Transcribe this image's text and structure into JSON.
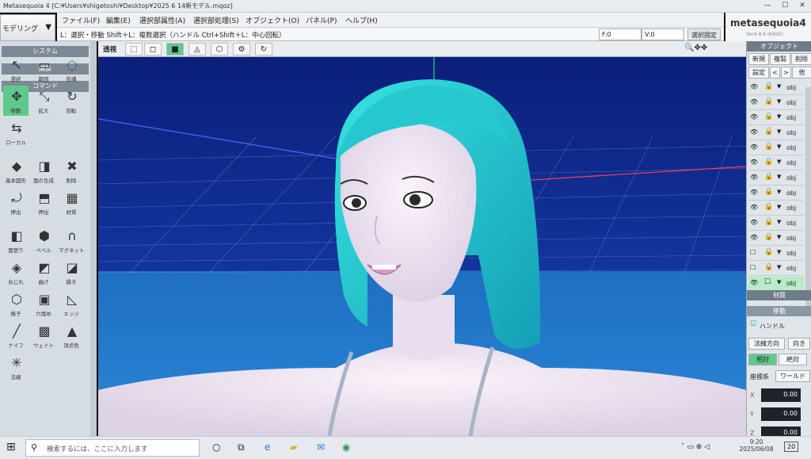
{
  "window": {
    "title": "Metasequoia 4 [C:¥Users¥shigetoshi¥Desktop¥2025 6 14新モデル.mqoz]",
    "min": "—",
    "max": "☐",
    "close": "✕"
  },
  "mode": {
    "label": "モデリング",
    "arrow": "▼"
  },
  "menu": [
    "ファイル(F)",
    "編集(E)",
    "選択部属性(A)",
    "選択部処理(S)",
    "オブジェクト(O)",
    "パネル(P)",
    "ヘルプ(H)"
  ],
  "hint": {
    "text": "L：選択・移動  Shift＋L：複数選択（ハンドル  Ctrl+Shift＋L：中心回転）",
    "f_label": "F:0",
    "v_label": "V:0",
    "fix_label": "選択固定"
  },
  "brand": {
    "name": "metasequoia4",
    "version": "Ver4.8.6 (64bit)"
  },
  "left": {
    "system": "システム",
    "edit": "編集",
    "command": "コマンド",
    "tools": [
      {
        "icon": "↖",
        "label": "選択"
      },
      {
        "icon": "▭",
        "label": "範囲"
      },
      {
        "icon": "◌",
        "label": "投縄"
      },
      {
        "icon": "✥",
        "label": "移動"
      },
      {
        "icon": "⤡",
        "label": "拡大"
      },
      {
        "icon": "↻",
        "label": "回転"
      },
      {
        "icon": "⇆",
        "label": "ローカル"
      },
      {
        "icon": "◆",
        "label": "基本図形"
      },
      {
        "icon": "◨",
        "label": "面の生成"
      },
      {
        "icon": "✖",
        "label": "削除"
      },
      {
        "icon": "⤾",
        "label": "押出"
      },
      {
        "icon": "⬒",
        "label": "押出"
      },
      {
        "icon": "▦",
        "label": "材質"
      },
      {
        "icon": "◧",
        "label": "面張り"
      },
      {
        "icon": "⬢",
        "label": "ベベル"
      },
      {
        "icon": "∩",
        "label": "マグネット"
      },
      {
        "icon": "◈",
        "label": "ねじれ"
      },
      {
        "icon": "◩",
        "label": "曲げ"
      },
      {
        "icon": "◪",
        "label": "縁き"
      },
      {
        "icon": "⬡",
        "label": "格子"
      },
      {
        "icon": "▣",
        "label": "穴埋め"
      },
      {
        "icon": "◺",
        "label": "エッジ"
      },
      {
        "icon": "╱",
        "label": "ナイフ"
      },
      {
        "icon": "▩",
        "label": "ウェイト"
      },
      {
        "icon": "▲",
        "label": "頂点色"
      },
      {
        "icon": "✳",
        "label": "法線"
      }
    ]
  },
  "viewport_toolbar": {
    "label": "透視",
    "buttons": [
      "⬚",
      "◻",
      "■",
      "◬",
      "⬡",
      "⚙",
      "↻"
    ],
    "nav": "🔍✥✥"
  },
  "right": {
    "objects_header": "オブジェクト",
    "new": "新規",
    "dup": "複製",
    "del": "削除",
    "settings": "設定",
    "prev": "<",
    "next": ">",
    "other": "他",
    "objects": [
      {
        "eye": "👁",
        "lock": "🔒",
        "name": "obj"
      },
      {
        "eye": "👁",
        "lock": "🔒",
        "name": "obj"
      },
      {
        "eye": "👁",
        "lock": "🔒",
        "name": "obj"
      },
      {
        "eye": "👁",
        "lock": "🔒",
        "name": "obj"
      },
      {
        "eye": "👁",
        "lock": "🔒",
        "name": "obj"
      },
      {
        "eye": "👁",
        "lock": "🔒",
        "name": "obj"
      },
      {
        "eye": "👁",
        "lock": "🔒",
        "name": "obj"
      },
      {
        "eye": "👁",
        "lock": "🔒",
        "name": "obj"
      },
      {
        "eye": "👁",
        "lock": "🔒",
        "name": "obj"
      },
      {
        "eye": "👁",
        "lock": "🔒",
        "name": "obj"
      },
      {
        "eye": "👁",
        "lock": "🔒",
        "name": "obj"
      },
      {
        "eye": "☐",
        "lock": "🔒",
        "name": "obj"
      },
      {
        "eye": "☐",
        "lock": "🔒",
        "name": "obj"
      },
      {
        "eye": "👁",
        "lock": "☐",
        "name": "obj"
      }
    ],
    "material_header": "材質",
    "move_header": "移動",
    "handle_check": "☑",
    "handle_label": "ハンドル",
    "normal_dir": "法線方向",
    "direction": "向き",
    "relative": "相対",
    "absolute": "絶対",
    "coord_label": "座標系",
    "world": "ワールド",
    "x_label": "X",
    "x_val": "0.00",
    "y_label": "Y",
    "y_val": "0.00",
    "z_label": "Z",
    "z_val": "0.00"
  },
  "taskbar": {
    "start": "⊞",
    "search_icon": "⚲",
    "search_placeholder": "検索するには、ここに入力します",
    "icons": [
      "○",
      "⧉",
      "e",
      "▰",
      "✉",
      "◉"
    ],
    "tray": "ˆ  ▭  ⊕  ◁",
    "time": "9:20",
    "date": "2025/06/08",
    "notif": "20"
  },
  "colors": {
    "accent_green": "#5fc98c",
    "sky": "#0e2a8c",
    "floor": "#1e6fbf",
    "hair": "#2fd9d6"
  }
}
